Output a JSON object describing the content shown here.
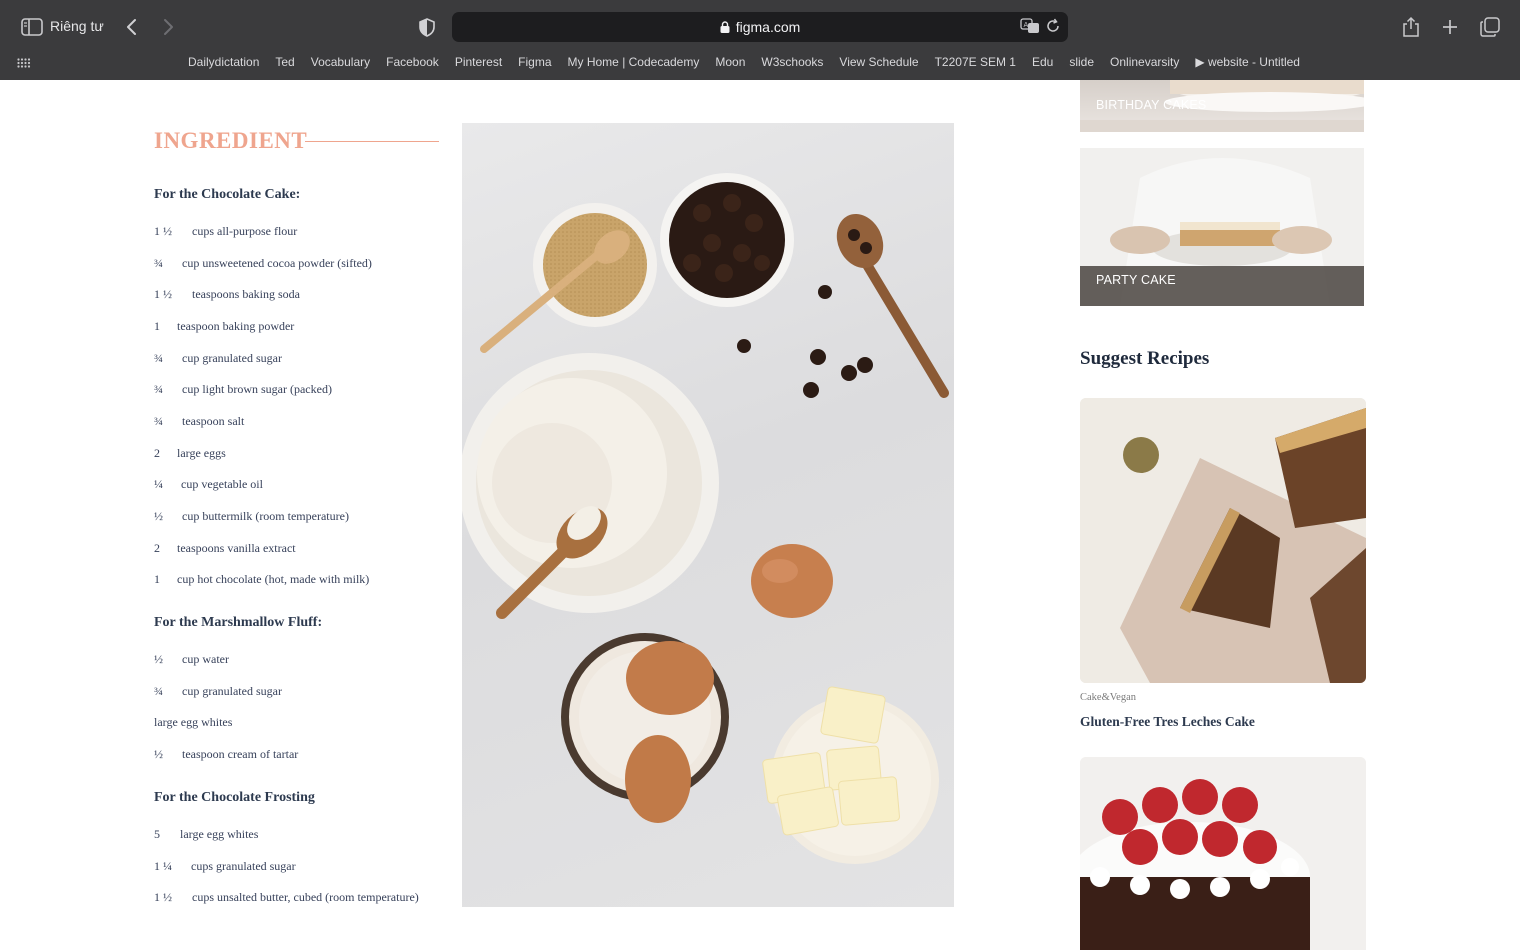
{
  "browser": {
    "private_label": "Riêng tư",
    "url": "figma.com",
    "bookmarks": [
      "Dailydictation",
      "Ted",
      "Vocabulary",
      "Facebook",
      "Pinterest",
      "Figma",
      "My Home | Codecademy",
      "Moon",
      "W3schooks",
      "View Schedule",
      "T2207E SEM 1",
      "Edu",
      "slide",
      "Onlinevarsity",
      "▶ website - Untitled"
    ]
  },
  "ingredients": {
    "title": "INGREDIENT",
    "chocolate_cake": {
      "heading": "For the Chocolate Cake:",
      "items": [
        {
          "qty": "1 ½",
          "name": "cups all-purpose flour"
        },
        {
          "qty": "¾",
          "name": "cup unsweetened cocoa powder (sifted)"
        },
        {
          "qty": "1 ½",
          "name": "teaspoons baking soda"
        },
        {
          "qty": "1",
          "name": "teaspoon baking powder"
        },
        {
          "qty": "¾",
          "name": "cup granulated sugar"
        },
        {
          "qty": "¾",
          "name": "cup light brown sugar (packed)"
        },
        {
          "qty": "¾",
          "name": "teaspoon salt"
        },
        {
          "qty": "2",
          "name": "large eggs"
        },
        {
          "qty": "¼",
          "name": "cup vegetable oil"
        },
        {
          "qty": "½",
          "name": "cup buttermilk (room temperature)"
        },
        {
          "qty": "2",
          "name": "teaspoons vanilla extract"
        },
        {
          "qty": "1",
          "name": "cup hot chocolate (hot, made with milk)"
        }
      ]
    },
    "marshmallow_fluff": {
      "heading": "For the Marshmallow Fluff:",
      "items": [
        {
          "qty": "½",
          "name": "cup water"
        },
        {
          "qty": "¾",
          "name": "cup granulated sugar"
        },
        {
          "qty": "",
          "name": "large egg whites"
        },
        {
          "qty": "½",
          "name": "teaspoon cream of tartar"
        }
      ]
    },
    "chocolate_frosting": {
      "heading": "For the Chocolate Frosting",
      "items": [
        {
          "qty": "5",
          "name": "large egg whites"
        },
        {
          "qty": "1 ¼",
          "name": "cups granulated sugar"
        },
        {
          "qty": "1 ½",
          "name": "cups unsalted butter, cubed (room temperature)"
        }
      ]
    }
  },
  "sidebar": {
    "categories": [
      {
        "label": "BIRTHDAY CAKES"
      },
      {
        "label": "PARTY CAKE"
      }
    ],
    "suggest_title": "Suggest Recipes",
    "recipes": [
      {
        "category": "Cake&Vegan",
        "title": "Gluten-Free Tres Leches Cake"
      }
    ]
  }
}
